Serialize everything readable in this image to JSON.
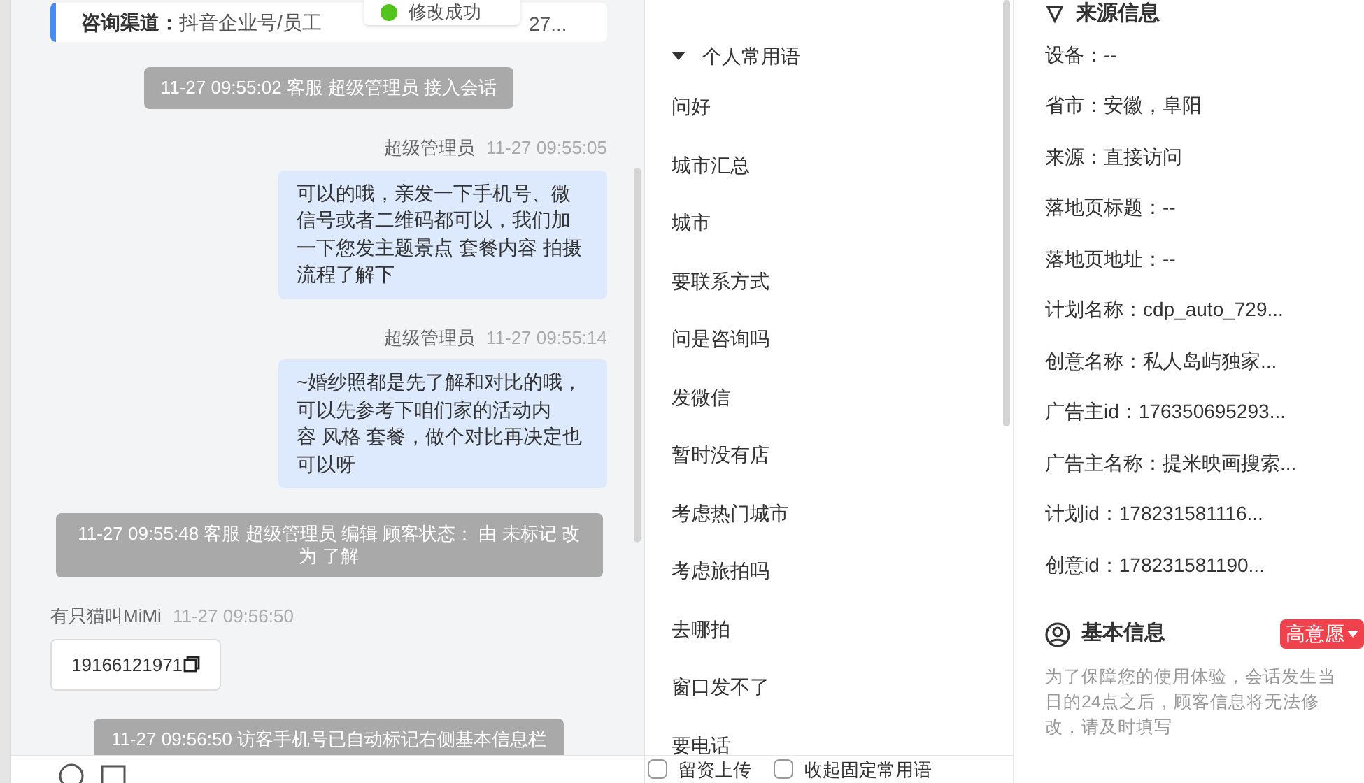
{
  "toast": {
    "text": "修改成功"
  },
  "channel_card": {
    "label": "咨询渠道：",
    "value": "抖音企业号/员工",
    "value_tail": "27..."
  },
  "messages": [
    {
      "kind": "system",
      "text": "11-27 09:55:02 客服 超级管理员 接入会话"
    },
    {
      "kind": "agent",
      "sender": "超级管理员",
      "time": "11-27 09:55:05",
      "text": "可以的哦，亲发一下手机号、微信号或者二维码都可以，我们加一下您发主题景点 套餐内容 拍摄流程了解下"
    },
    {
      "kind": "agent",
      "sender": "超级管理员",
      "time": "11-27 09:55:14",
      "text": "~婚纱照都是先了解和对比的哦，可以先参考下咱们家的活动内容 风格 套餐，做个对比再决定也可以呀"
    },
    {
      "kind": "system",
      "text": "11-27 09:55:48 客服 超级管理员 编辑 顾客状态： 由 未标记 改为 了解"
    },
    {
      "kind": "customer",
      "sender": "有只猫叫MiMi",
      "time": "11-27 09:56:50",
      "text": "19166121971"
    },
    {
      "kind": "system",
      "text": "11-27 09:56:50 访客手机号已自动标记右侧基本信息栏"
    }
  ],
  "phrases": {
    "group": "个人常用语",
    "expanded": true,
    "items": [
      "问好",
      "城市汇总",
      "城市",
      "要联系方式",
      "问是咨询吗",
      "发微信",
      "暂时没有店",
      "考虑热门城市",
      "考虑旅拍吗",
      "去哪拍",
      "窗口发不了",
      "要电话"
    ]
  },
  "phrase_options": [
    {
      "label": "留资上传",
      "checked": false
    },
    {
      "label": "收起固定常用语",
      "checked": false
    }
  ],
  "source_info": {
    "title": "来源信息",
    "fields": [
      "设备：--",
      "省市：安徽，阜阳",
      "来源：直接访问",
      "落地页标题：--",
      "落地页地址：--",
      "计划名称：cdp_auto_729...",
      "创意名称：私人岛屿独家...",
      "广告主id：176350695293...",
      "广告主名称：提米映画搜索...",
      "计划id：178231581116...",
      "创意id：178231581190..."
    ]
  },
  "basic_info": {
    "title": "基本信息",
    "tag": {
      "text": "高意愿",
      "color": "#f0424d"
    },
    "note": "为了保障您的使用体验，会话发生当日的24点之后，顾客信息将无法修改，请及时填写"
  }
}
